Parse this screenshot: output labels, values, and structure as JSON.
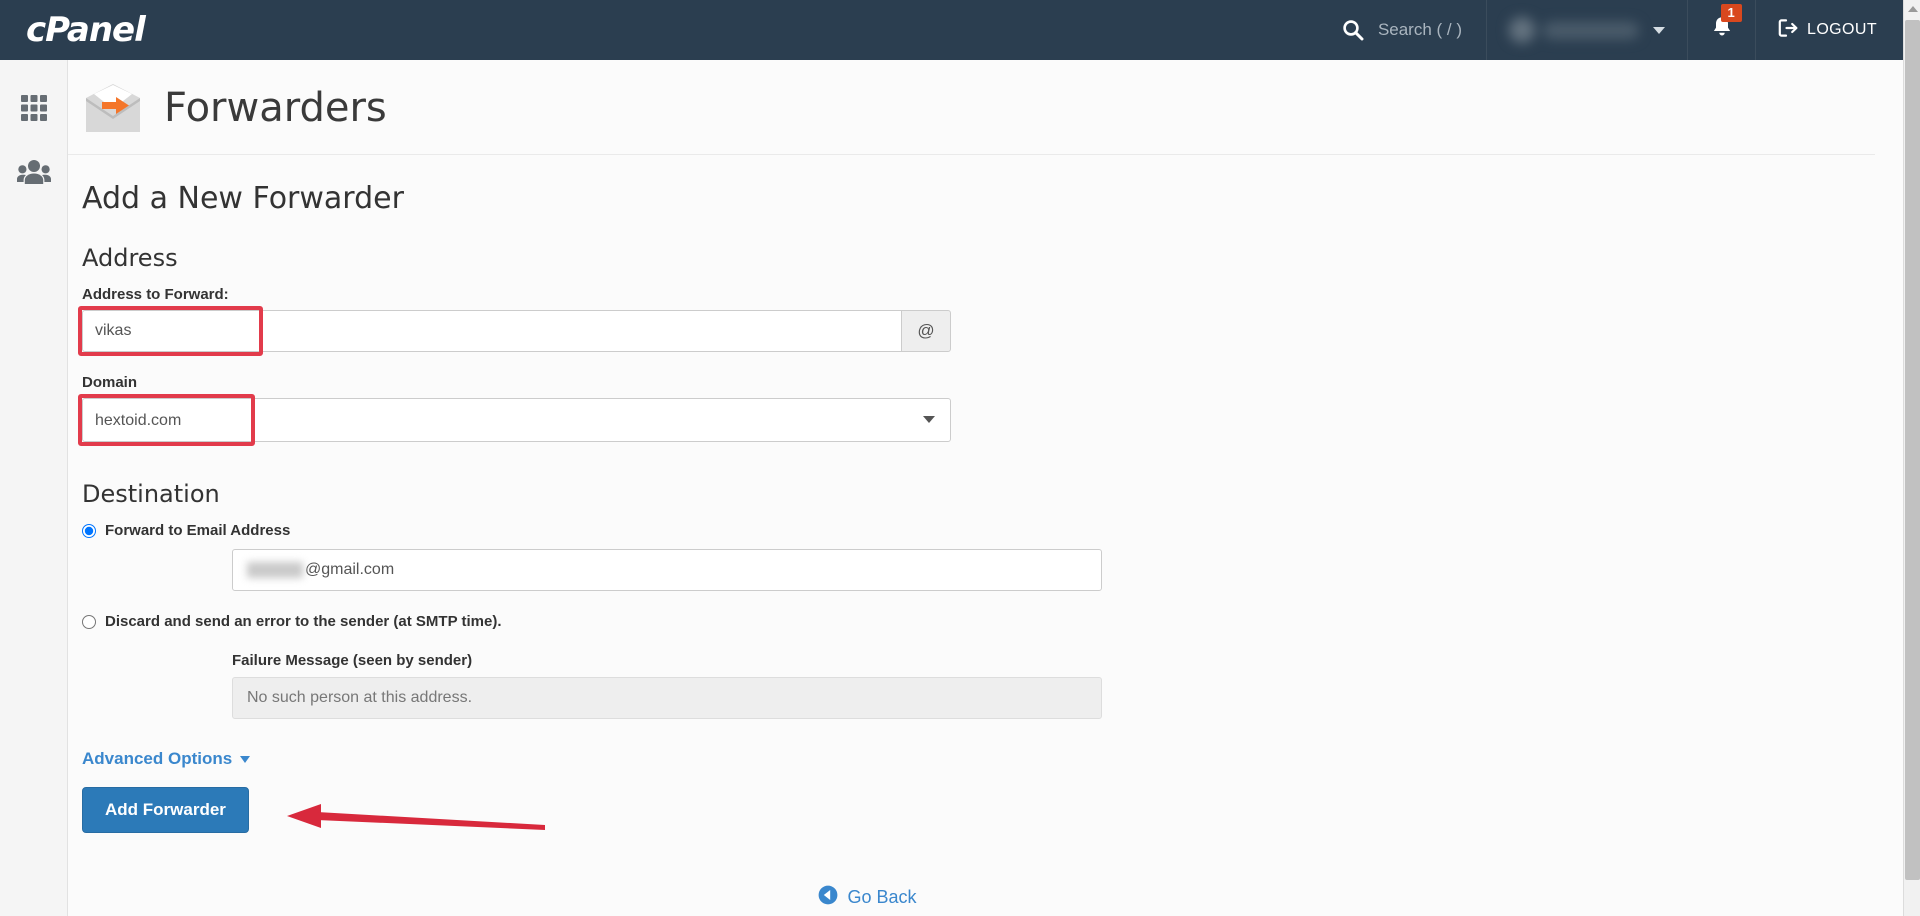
{
  "header": {
    "logo": "cPanel",
    "search_placeholder": "Search ( / )",
    "notification_count": "1",
    "logout_label": "LOGOUT",
    "bg_color": "#2b3e50"
  },
  "sidebar": {
    "items": [
      {
        "name": "apps-grid",
        "icon": "grid-icon"
      },
      {
        "name": "user-manager",
        "icon": "users-icon"
      }
    ]
  },
  "page": {
    "title": "Forwarders",
    "icon": "envelope-forward-icon"
  },
  "form": {
    "heading": "Add a New Forwarder",
    "address_section": {
      "heading": "Address",
      "label": "Address to Forward:",
      "value": "vikas",
      "at_symbol": "@"
    },
    "domain_section": {
      "label": "Domain",
      "selected": "hextoid.com",
      "options": [
        "hextoid.com"
      ]
    },
    "destination_section": {
      "heading": "Destination",
      "forward_radio_label": "Forward to Email Address",
      "forward_radio_selected": true,
      "email_value_suffix": "@gmail.com",
      "discard_radio_label": "Discard and send an error to the sender (at SMTP time).",
      "discard_radio_selected": false,
      "failure_label": "Failure Message (seen by sender)",
      "failure_value": "No such person at this address."
    },
    "advanced_options_label": "Advanced Options",
    "submit_label": "Add Forwarder"
  },
  "footer": {
    "go_back_label": "Go Back"
  },
  "annotations": {
    "highlight_color": "#e23b4b",
    "arrow_color": "#d8293c"
  },
  "theme": {
    "primary_button": "#2c7ab8",
    "link_color": "#3a87cd",
    "badge_color": "#d9481e"
  }
}
